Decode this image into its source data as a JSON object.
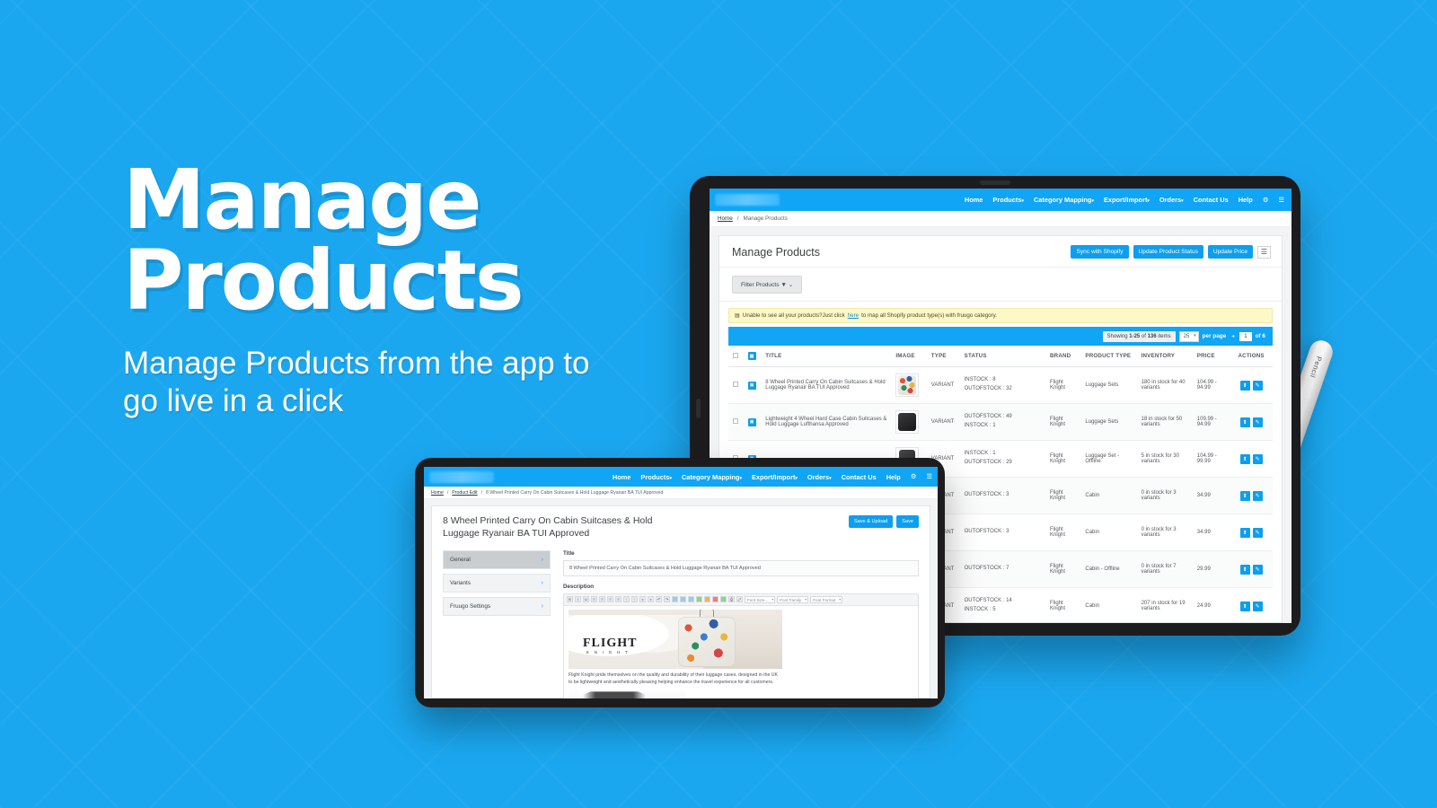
{
  "theme": {
    "bg": "#1ba7ef",
    "accent": "#0d9ef0",
    "navbar": "#10a5f5",
    "alert_bg": "#fcf8c8"
  },
  "hero": {
    "title_line1": "Manage",
    "title_line2": "Products",
    "subtitle": "Manage Products from the app to go live in a click"
  },
  "tablet": {
    "nav": {
      "logo_alt": "app-logo",
      "items": [
        {
          "label": "Home",
          "caret": false
        },
        {
          "label": "Products",
          "caret": true
        },
        {
          "label": "Category Mapping",
          "caret": true
        },
        {
          "label": "Export/Import",
          "caret": true
        },
        {
          "label": "Orders",
          "caret": true
        },
        {
          "label": "Contact Us",
          "caret": false
        },
        {
          "label": "Help",
          "caret": false
        }
      ],
      "gear": "⚙",
      "burger": "☰",
      "burger_caret": "▾"
    },
    "breadcrumb": {
      "home": "Home",
      "sep": "/",
      "current": "Manage Products"
    },
    "page_title": "Manage Products",
    "buttons": {
      "sync": "Sync with Shopify",
      "update_status": "Update Product Status",
      "update_price": "Update Price",
      "list_icon": "☰"
    },
    "filter": {
      "label": "Filter Products",
      "funnel": "▼",
      "caret": "˅"
    },
    "alert": {
      "icon": "▤",
      "text_before": "Unable to see all your products?Just click ",
      "link": "here",
      "text_after": " to map all Shopify product type(s) with fruugo category."
    },
    "pagination": {
      "showing_prefix": "Showing ",
      "range": "1-25",
      "showing_mid": " of ",
      "total": "136",
      "showing_suffix": " items",
      "per_page_value": "25",
      "per_page_label": "per page",
      "prev": "◂",
      "page": "1",
      "of_pages": "of 6",
      "next": "▸"
    },
    "table": {
      "headers": [
        "",
        "",
        "TITLE",
        "IMAGE",
        "TYPE",
        "STATUS",
        "BRAND",
        "PRODUCT TYPE",
        "INVENTORY",
        "PRICE",
        "ACTIONS"
      ],
      "rows": [
        {
          "title": "8 Wheel Printed Carry On Cabin Suitcases & Hold Luggage Ryanair BA TUI Approved",
          "type": "VARIANT",
          "status1": "INSTOCK : 8",
          "status2": "OUTOFSTOCK : 32",
          "brand": "Flight Knight",
          "product_type": "Luggage Sets",
          "inventory": "180 in stock for 40 variants",
          "price": "104.99 - 94.99",
          "thumb": "printed-suitcase"
        },
        {
          "title": "Lightweight 4 Wheel Hard Case Cabin Suitcases & Hold Luggage Lufthansa Approved",
          "type": "VARIANT",
          "status1": "OUTOFSTOCK : 49",
          "status2": "INSTOCK : 1",
          "brand": "Flight Knight",
          "product_type": "Luggage Sets",
          "inventory": "18 in stock for 50 variants",
          "price": "109.99 - 94.99",
          "thumb": "black-suitcase-set"
        },
        {
          "title": "",
          "type": "VARIANT",
          "status1": "INSTOCK : 1",
          "status2": "OUTOFSTOCK : 29",
          "brand": "Flight Knight",
          "product_type": "Luggage Set - Offline",
          "inventory": "5 in stock for 30 variants",
          "price": "104.99 - 99.99",
          "thumb": "suitcase"
        },
        {
          "title": "",
          "type": "VARIANT",
          "status1": "OUTOFSTOCK : 3",
          "status2": "",
          "brand": "Flight Knight",
          "product_type": "Cabin",
          "inventory": "0 in stock for 3 variants",
          "price": "34.99",
          "thumb": "suitcase"
        },
        {
          "title": "",
          "type": "VARIANT",
          "status1": "OUTOFSTOCK : 3",
          "status2": "",
          "brand": "Flight Knight",
          "product_type": "Cabin",
          "inventory": "0 in stock for 3 variants",
          "price": "34.99",
          "thumb": "suitcase"
        },
        {
          "title": "",
          "type": "VARIANT",
          "status1": "OUTOFSTOCK : 7",
          "status2": "",
          "brand": "Flight Knight",
          "product_type": "Cabin - Offline",
          "inventory": "0 in stock for 7 variants",
          "price": "29.99",
          "thumb": "suitcase"
        },
        {
          "title": "",
          "type": "VARIANT",
          "status1": "OUTOFSTOCK : 14",
          "status2": "INSTOCK : 5",
          "brand": "Flight Knight",
          "product_type": "Cabin",
          "inventory": "207 in stock for 19 variants",
          "price": "24.99",
          "thumb": "suitcase"
        }
      ]
    }
  },
  "tablet2": {
    "nav": {
      "items": [
        {
          "label": "Home",
          "caret": false
        },
        {
          "label": "Products",
          "caret": true
        },
        {
          "label": "Category Mapping",
          "caret": true
        },
        {
          "label": "Export/Import",
          "caret": true
        },
        {
          "label": "Orders",
          "caret": true
        },
        {
          "label": "Contact Us",
          "caret": false
        },
        {
          "label": "Help",
          "caret": false
        }
      ],
      "gear": "⚙",
      "burger": "☰",
      "burger_caret": "▾"
    },
    "breadcrumb": {
      "home": "Home",
      "sep1": "/",
      "middle": "Product Edit",
      "sep2": "/",
      "current": "8 Wheel Printed Carry On Cabin Suitcases & Hold Luggage Ryanair BA TUI Approved"
    },
    "edit_title": "8 Wheel Printed Carry On Cabin Suitcases & Hold Luggage Ryanair BA TUI Approved",
    "buttons": {
      "save_upload": "Save & Upload",
      "save": "Save"
    },
    "tabs": [
      {
        "label": "General",
        "active": true
      },
      {
        "label": "Variants",
        "active": false
      },
      {
        "label": "Fruugo Settings",
        "active": false
      }
    ],
    "fields": {
      "title_label": "Title",
      "title_value": "8 Wheel Printed Carry On Cabin Suitcases & Hold Luggage Ryanair BA TUI Approved",
      "description_label": "Description"
    },
    "editor": {
      "selects": [
        "Font Size...",
        "Font Family",
        "Font Format"
      ],
      "brand_logo": "FLIGHT",
      "brand_sub": "K N I G H T",
      "body_text": "Flight Knight pride themselves on the quality and durability of their luggage cases, designed in the UK to be lightweight and aesthetically pleasing helping enhance the travel experience for all customers."
    }
  },
  "pencil": {
    "label": "Pencil"
  }
}
